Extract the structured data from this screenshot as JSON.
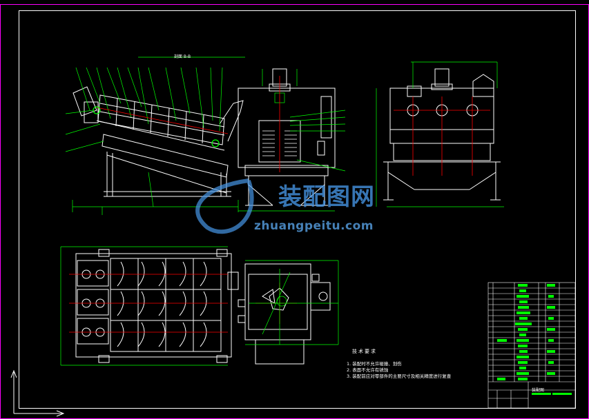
{
  "watermark": {
    "brand_cn": "装配图网",
    "url": "zhuangpeitu.com"
  },
  "technical_notes": {
    "title": "技术要求",
    "items": [
      "1. 装配时不允许碰撞、划伤",
      "2. 表面不允许有锈蚀",
      "3. 装配前应对零部件的主要尺寸及相关精度进行复查"
    ]
  },
  "section_label": "剖面 B-B",
  "title_block": {
    "drawing_name": "装配图"
  },
  "colors": {
    "background": "#000000",
    "frame": "#ff00ff",
    "outline": "#ffffff",
    "leader": "#00ff00",
    "centerline": "#ff0000",
    "watermark": "#4a96e6"
  }
}
